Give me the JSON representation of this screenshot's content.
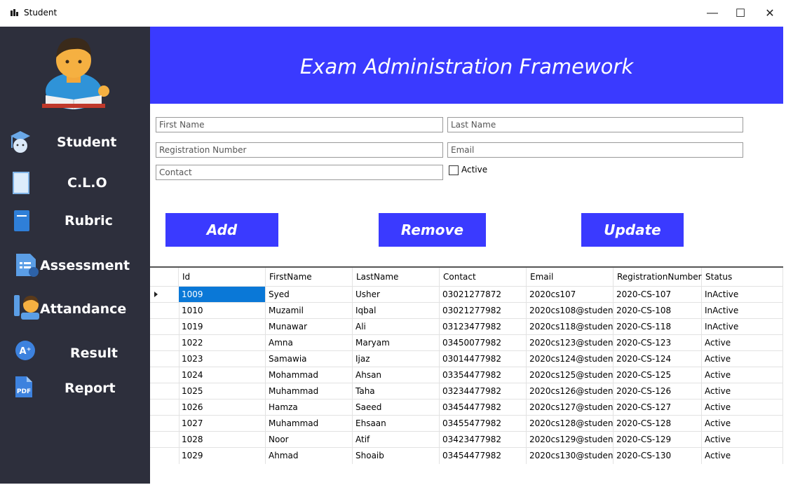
{
  "window": {
    "title": "Student",
    "minimize": "—",
    "maximize": "☐",
    "close": "✕"
  },
  "sidebar": {
    "items": [
      {
        "label": "Student",
        "icon": "graduate-icon"
      },
      {
        "label": "C.L.O",
        "icon": "notebook-icon"
      },
      {
        "label": "Rubric",
        "icon": "book-icon"
      },
      {
        "label": "Assessment",
        "icon": "assessment-icon"
      },
      {
        "label": "Attandance",
        "icon": "attendance-icon"
      },
      {
        "label": "Result",
        "icon": "result-icon"
      },
      {
        "label": "Report",
        "icon": "pdf-icon"
      }
    ]
  },
  "header": {
    "title": "Exam Administration Framework"
  },
  "form": {
    "first_name_placeholder": "First Name",
    "last_name_placeholder": "Last Name",
    "registration_placeholder": "Registration Number",
    "email_placeholder": "Email",
    "contact_placeholder": "Contact",
    "active_label": "Active"
  },
  "buttons": {
    "add": "Add",
    "remove": "Remove",
    "update": "Update"
  },
  "grid": {
    "columns": [
      "Id",
      "FirstName",
      "LastName",
      "Contact",
      "Email",
      "RegistrationNumber",
      "Status"
    ],
    "rows": [
      [
        "1009",
        "Syed",
        "Usher",
        "03021277872",
        "2020cs107",
        "2020-CS-107",
        "InActive"
      ],
      [
        "1010",
        "Muzamil",
        "Iqbal",
        "03021277982",
        "2020cs108@studen...",
        "2020-CS-108",
        "InActive"
      ],
      [
        "1019",
        "Munawar",
        "Ali",
        "03123477982",
        "2020cs118@studen...",
        "2020-CS-118",
        "InActive"
      ],
      [
        "1022",
        "Amna",
        "Maryam",
        "03450077982",
        "2020cs123@studen...",
        "2020-CS-123",
        "Active"
      ],
      [
        "1023",
        "Samawia",
        "Ijaz",
        "03014477982",
        "2020cs124@studen...",
        "2020-CS-124",
        "Active"
      ],
      [
        "1024",
        "Mohammad",
        "Ahsan",
        "03354477982",
        "2020cs125@studen...",
        "2020-CS-125",
        "Active"
      ],
      [
        "1025",
        "Muhammad",
        "Taha",
        "03234477982",
        "2020cs126@studen...",
        "2020-CS-126",
        "Active"
      ],
      [
        "1026",
        "Hamza",
        "Saeed",
        "03454477982",
        "2020cs127@studen...",
        "2020-CS-127",
        "Active"
      ],
      [
        "1027",
        "Muhammad",
        "Ehsaan",
        "03455477982",
        "2020cs128@studen...",
        "2020-CS-128",
        "Active"
      ],
      [
        "1028",
        "Noor",
        "Atif",
        "03423477982",
        "2020cs129@studen...",
        "2020-CS-129",
        "Active"
      ],
      [
        "1029",
        "Ahmad",
        "Shoaib",
        "03454477982",
        "2020cs130@studen...",
        "2020-CS-130",
        "Active"
      ]
    ]
  }
}
